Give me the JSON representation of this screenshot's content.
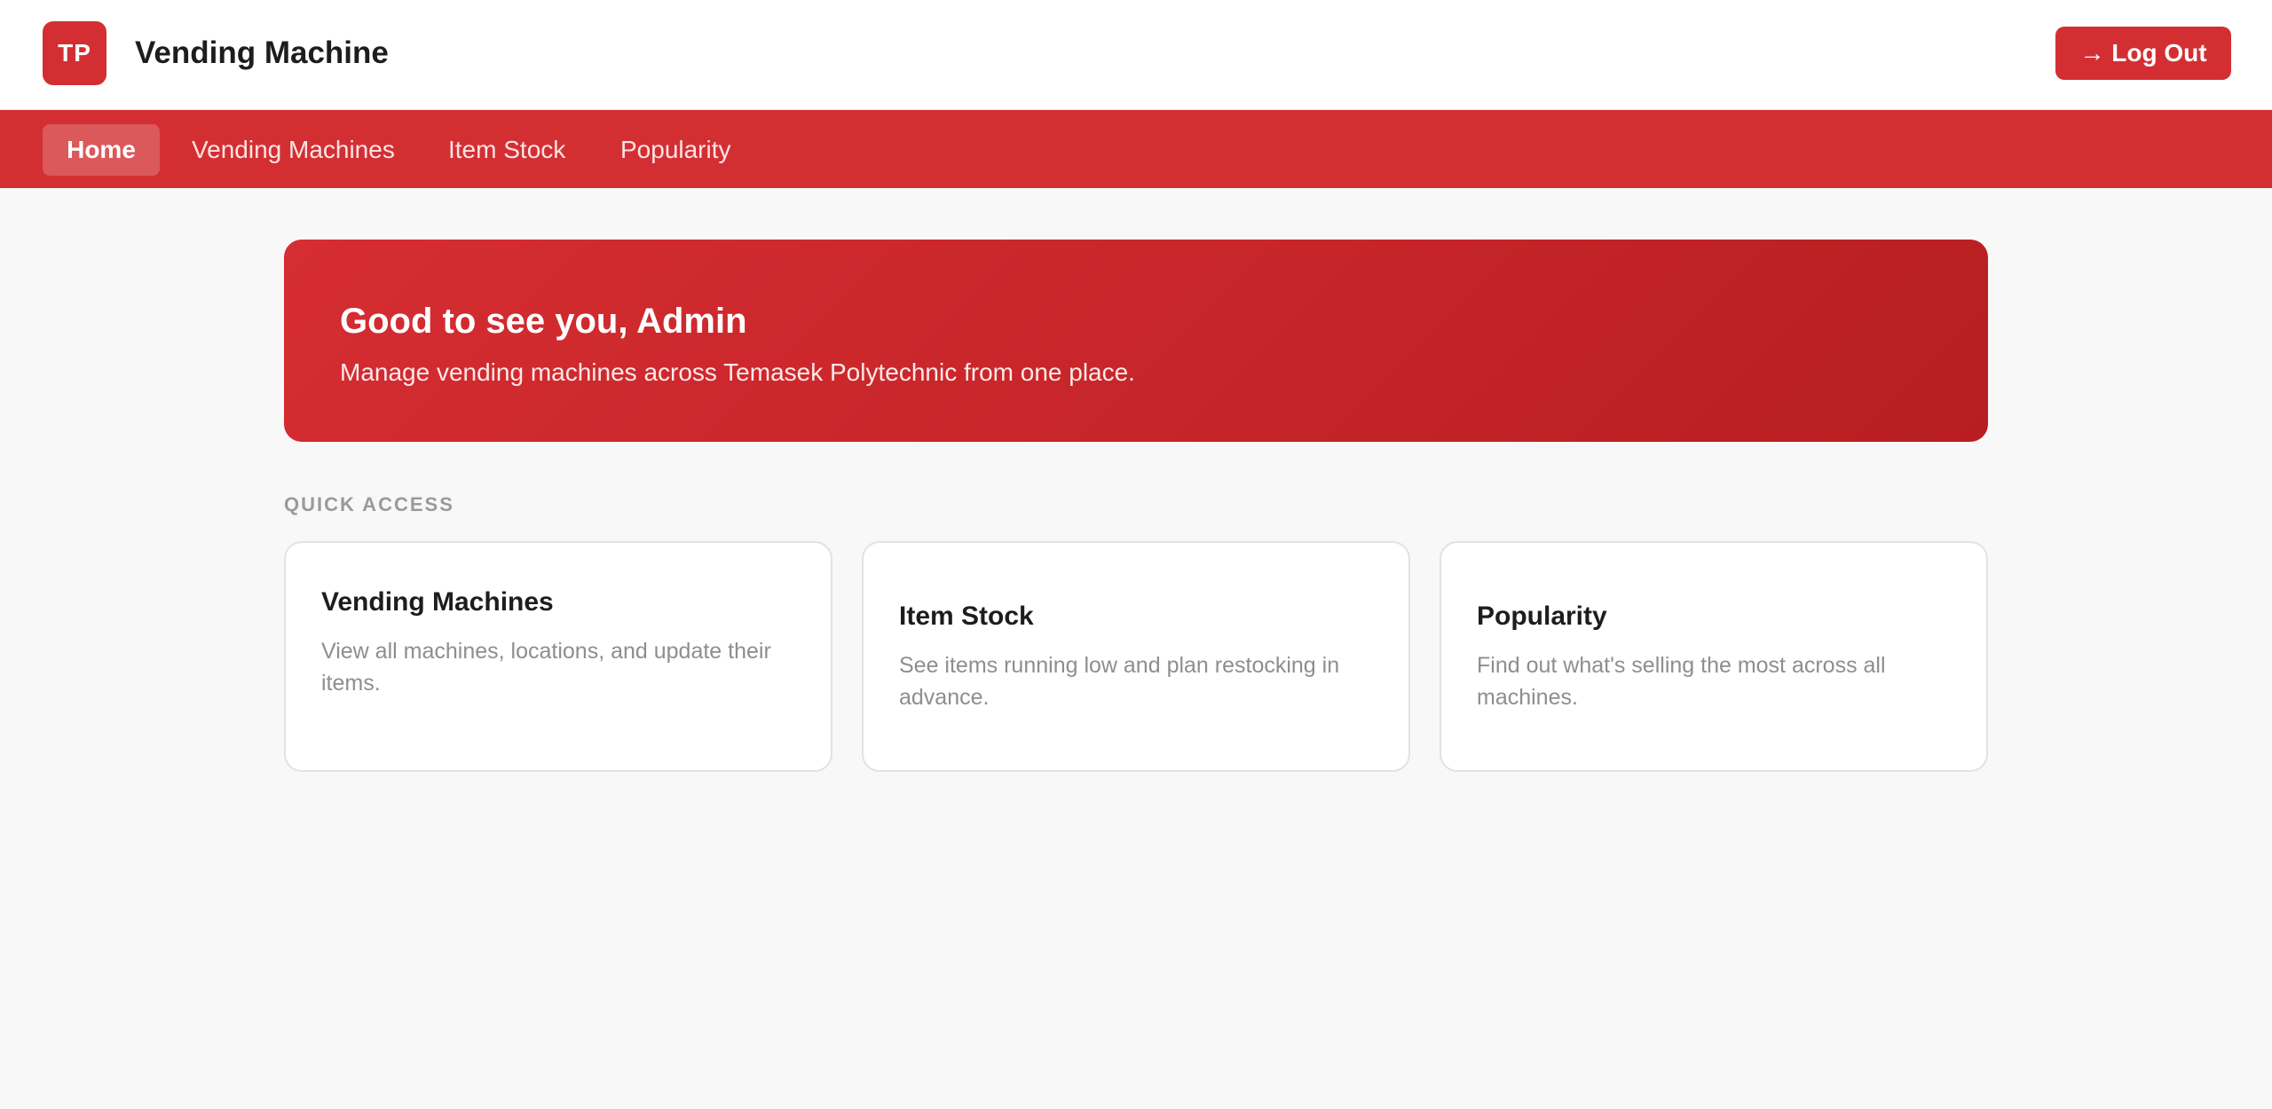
{
  "header": {
    "logo_text": "TP",
    "title": "Vending Machine",
    "logout_label": "→ Log Out"
  },
  "nav": {
    "items": [
      {
        "label": "Home"
      },
      {
        "label": "Vending Machines"
      },
      {
        "label": "Item Stock"
      },
      {
        "label": "Popularity"
      }
    ]
  },
  "hero": {
    "title": "Good to see you, Admin",
    "subtitle": "Manage vending machines across Temasek Polytechnic from one place."
  },
  "quick_access": {
    "label": "QUICK ACCESS",
    "cards": [
      {
        "title": "Vending Machines",
        "description": "View all machines, locations, and update their items."
      },
      {
        "title": "Item Stock",
        "description": "See items running low and plan restocking in advance."
      },
      {
        "title": "Popularity",
        "description": "Find out what's selling the most across all machines."
      }
    ]
  },
  "colors": {
    "brand": "#d32f33",
    "background": "#f8f8f8"
  }
}
